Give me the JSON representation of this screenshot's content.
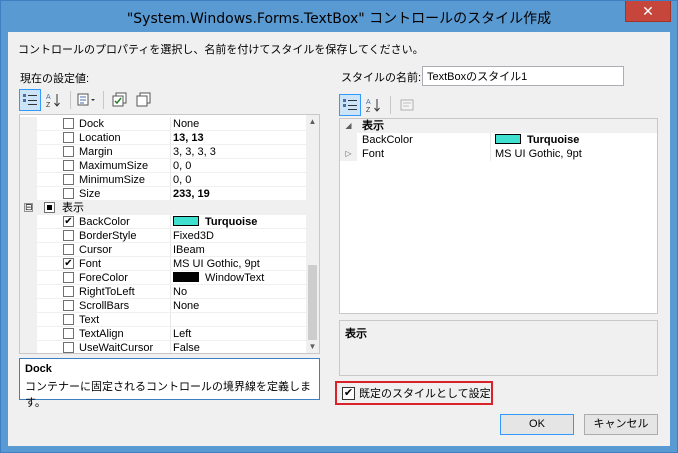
{
  "window": {
    "title": "\"System.Windows.Forms.TextBox\" コントロールのスタイル作成",
    "close_glyph": "✕"
  },
  "instruction": "コントロールのプロパティを選択し、名前を付けてスタイルを保存してください。",
  "left": {
    "label": "現在の設定値:",
    "properties": [
      {
        "name": "Dock",
        "value": "None",
        "checked": false,
        "bold": false
      },
      {
        "name": "Location",
        "value": "13, 13",
        "checked": false,
        "bold": true
      },
      {
        "name": "Margin",
        "value": "3, 3, 3, 3",
        "checked": false,
        "bold": false
      },
      {
        "name": "MaximumSize",
        "value": "0, 0",
        "checked": false,
        "bold": false
      },
      {
        "name": "MinimumSize",
        "value": "0, 0",
        "checked": false,
        "bold": false
      },
      {
        "name": "Size",
        "value": "233, 19",
        "checked": false,
        "bold": true
      }
    ],
    "category": {
      "name": "表示",
      "expander": "⊟"
    },
    "display_properties": [
      {
        "name": "BackColor",
        "value": "Turquoise",
        "checked": true,
        "bold": true,
        "swatch": "#40e0d0"
      },
      {
        "name": "BorderStyle",
        "value": "Fixed3D",
        "checked": false,
        "bold": false
      },
      {
        "name": "Cursor",
        "value": "IBeam",
        "checked": false,
        "bold": false
      },
      {
        "name": "Font",
        "value": "MS UI Gothic, 9pt",
        "checked": true,
        "bold": false
      },
      {
        "name": "ForeColor",
        "value": "WindowText",
        "checked": false,
        "bold": false,
        "swatch": "#000000"
      },
      {
        "name": "RightToLeft",
        "value": "No",
        "checked": false,
        "bold": false
      },
      {
        "name": "ScrollBars",
        "value": "None",
        "checked": false,
        "bold": false
      },
      {
        "name": "Text",
        "value": "",
        "checked": false,
        "bold": false
      },
      {
        "name": "TextAlign",
        "value": "Left",
        "checked": false,
        "bold": false
      },
      {
        "name": "UseWaitCursor",
        "value": "False",
        "checked": false,
        "bold": false
      }
    ],
    "description": {
      "title": "Dock",
      "text": "コンテナーに固定されるコントロールの境界線を定義します。"
    }
  },
  "right": {
    "style_name_label": "スタイルの名前:",
    "style_name_value": "TextBoxのスタイル1",
    "category": {
      "name": "表示",
      "expander": "◢"
    },
    "properties": [
      {
        "name": "BackColor",
        "value": "Turquoise",
        "bold": true,
        "swatch": "#40e0d0",
        "expander": ""
      },
      {
        "name": "Font",
        "value": "MS UI Gothic, 9pt",
        "bold": false,
        "expander": "▷"
      }
    ],
    "description": {
      "title": "表示"
    },
    "default_checkbox": {
      "label": "既定のスタイルとして設定",
      "checked": true,
      "check_glyph": "✔"
    }
  },
  "buttons": {
    "ok": "OK",
    "cancel": "キャンセル"
  },
  "icons": {
    "checked_glyph": "✔",
    "scroll_up": "▲",
    "scroll_down": "▼"
  }
}
